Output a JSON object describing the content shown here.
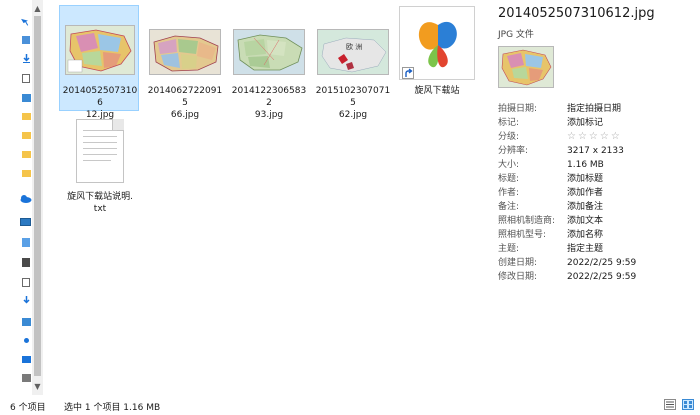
{
  "files": [
    {
      "name_line1": "20140525073106",
      "name_line2": "12.jpg",
      "selected": true
    },
    {
      "name_line1": "20140627220915",
      "name_line2": "66.jpg",
      "selected": false
    },
    {
      "name_line1": "20141223065832",
      "name_line2": "93.jpg",
      "selected": false
    },
    {
      "name_line1": "20151023070715",
      "name_line2": "62.jpg",
      "selected": false
    },
    {
      "name_line1": "旋风下载站",
      "name_line2": "",
      "selected": false
    },
    {
      "name_line1": "旋风下载站说明.",
      "name_line2": "txt",
      "selected": false
    }
  ],
  "map_label": "欧 洲",
  "details": {
    "title": "20140525073106​12.jpg",
    "type": "JPG 文件",
    "properties": [
      {
        "name": "拍摄日期:",
        "value": "指定拍摄日期"
      },
      {
        "name": "标记:",
        "value": "添加标记"
      },
      {
        "name": "分级:",
        "value": "☆☆☆☆☆"
      },
      {
        "name": "分辨率:",
        "value": "3217 x 2133"
      },
      {
        "name": "大小:",
        "value": "1.16 MB"
      },
      {
        "name": "标题:",
        "value": "添加标题"
      },
      {
        "name": "作者:",
        "value": "添加作者"
      },
      {
        "name": "备注:",
        "value": "添加备注"
      },
      {
        "name": "照相机制造商:",
        "value": "添加文本"
      },
      {
        "name": "照相机型号:",
        "value": "添加名称"
      },
      {
        "name": "主题:",
        "value": "指定主题"
      },
      {
        "name": "创建日期:",
        "value": "2022/2/25 9:59"
      },
      {
        "name": "修改日期:",
        "value": "2022/2/25 9:59"
      }
    ]
  },
  "status": {
    "item_count": "6 个项目",
    "selection": "选中 1 个项目  1.16 MB"
  },
  "colors": {
    "selection_bg": "#cce8ff",
    "selection_border": "#99d1ff",
    "nav_accent": "#1a73d9",
    "folder_yellow": "#f5c44a"
  },
  "icons": {
    "pin": "pin-icon",
    "scroll_up": "chevron-up-icon",
    "scroll_down": "chevron-down-icon",
    "details_view": "details-view-icon",
    "large_icons_view": "large-icons-view-icon"
  }
}
